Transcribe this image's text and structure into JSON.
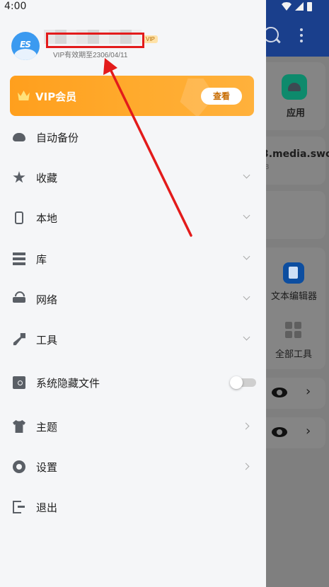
{
  "status_bar": {
    "time": "4:00"
  },
  "profile": {
    "vip_badge": "VIP",
    "expiry": "VIP有效期至2306/04/11",
    "avatar_logo": "ES"
  },
  "vip_card": {
    "title": "VIP会员",
    "button": "查看"
  },
  "menu": [
    {
      "label": "自动备份",
      "icon": "cloud-backup-icon",
      "trailing": "none"
    },
    {
      "label": "收藏",
      "icon": "star-icon",
      "trailing": "chevron-down"
    },
    {
      "label": "本地",
      "icon": "phone-icon",
      "trailing": "chevron-down"
    },
    {
      "label": "库",
      "icon": "layers-icon",
      "trailing": "chevron-down"
    },
    {
      "label": "网络",
      "icon": "router-icon",
      "trailing": "chevron-down"
    },
    {
      "label": "工具",
      "icon": "wrench-icon",
      "trailing": "chevron-down"
    },
    {
      "label": "系统隐藏文件",
      "icon": "hidden-file-icon",
      "trailing": "toggle",
      "toggle_on": false
    },
    {
      "label": "主题",
      "icon": "shirt-icon",
      "trailing": "chevron-right"
    },
    {
      "label": "设置",
      "icon": "gear-icon",
      "trailing": "chevron-right"
    },
    {
      "label": "退出",
      "icon": "exit-icon",
      "trailing": "none"
    }
  ],
  "background_app": {
    "apps_label": "应用",
    "file_name": "3.media.swc...",
    "file_sub": "8",
    "text_editor": "文本编辑器",
    "all_tools": "全部工具"
  },
  "colors": {
    "vip_orange": "#ff9f1d",
    "highlight_red": "#e31b1b",
    "header_blue": "#1a3f8c"
  }
}
